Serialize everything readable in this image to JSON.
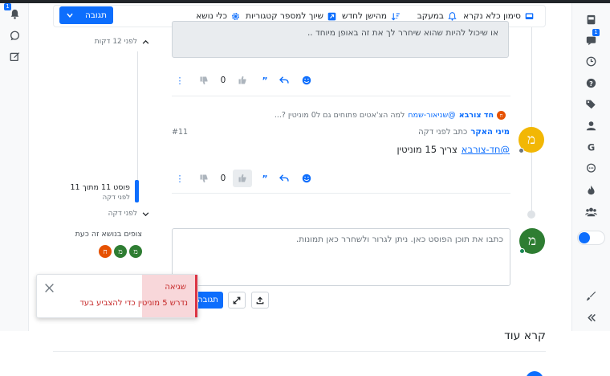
{
  "toolbar": {
    "reply_label": "תגובה",
    "items": [
      {
        "label": "סימון כלא נקרא",
        "icon": "inbox-icon"
      },
      {
        "label": "במעקב",
        "icon": "bell-icon"
      },
      {
        "label": "מהישן לחדש",
        "icon": "sort-icon"
      },
      {
        "label": "שיוך למספר קטגוריות",
        "icon": "external-link-icon"
      },
      {
        "label": "כלי נושא",
        "icon": "gear-icon"
      }
    ]
  },
  "right_sidebar": {
    "badge_count": "1",
    "icons": [
      "inbox-icon",
      "chat-icon",
      "clock-icon",
      "help-icon",
      "tags-icon",
      "user-icon",
      "google-icon",
      "comment-icon",
      "fire-icon",
      "users-icon",
      "toggle-icon",
      "brush-icon",
      "collapse-icon"
    ]
  },
  "left_sidebar": {
    "badge_count": "1",
    "icons": [
      "bell-icon",
      "chat-icon",
      "edit-icon"
    ]
  },
  "posts": {
    "quoted_text": "או שיכול להיות שהוא שיחרר לך את זה באופן מיוחד ..",
    "post1_likes": "0",
    "quote_line": {
      "author_initial": "ח",
      "author": "חד צורבא",
      "mention": "@שניאור-שמח",
      "text": "למה הצ'אטים פתוחים גם ל0 מוניטין ?..."
    },
    "post2": {
      "author": "מיני האקר",
      "meta": "כתב לפני דקה",
      "index": "#11",
      "avatar_initial": "מ",
      "mention": "@חד-צורבא",
      "body": "צריך 15 מוניטין",
      "likes": "0"
    }
  },
  "timeline": {
    "top_label": "לפני 12 דקות",
    "position_label": "פוסט 11 מתוך 11",
    "position_sub": "לפני דקה",
    "bottom_label": "לפני דקה"
  },
  "viewers": {
    "label": "צופים בנושא זה כעת",
    "avatars": [
      {
        "initial": "מ",
        "color": "#2e7d32"
      },
      {
        "initial": "מ",
        "color": "#2e7d32"
      },
      {
        "initial": "ח",
        "color": "#e65100"
      }
    ]
  },
  "composer": {
    "placeholder": "כתבו את תוכן הפוסט כאן. ניתן לגרור ולשחרר כאן תמונות.",
    "avatar_initial": "מ",
    "submit_label": "תגובה"
  },
  "toast": {
    "title": "שגיאה",
    "message": "נדרש 5 מוניטין כדי להצביע בעד"
  },
  "read_more": "קרא עוד",
  "colors": {
    "primary": "#0d6efd",
    "danger": "#dc3545",
    "avatar_yellow": "#f2b705",
    "avatar_green": "#2e7d32",
    "avatar_orange": "#e65100"
  }
}
